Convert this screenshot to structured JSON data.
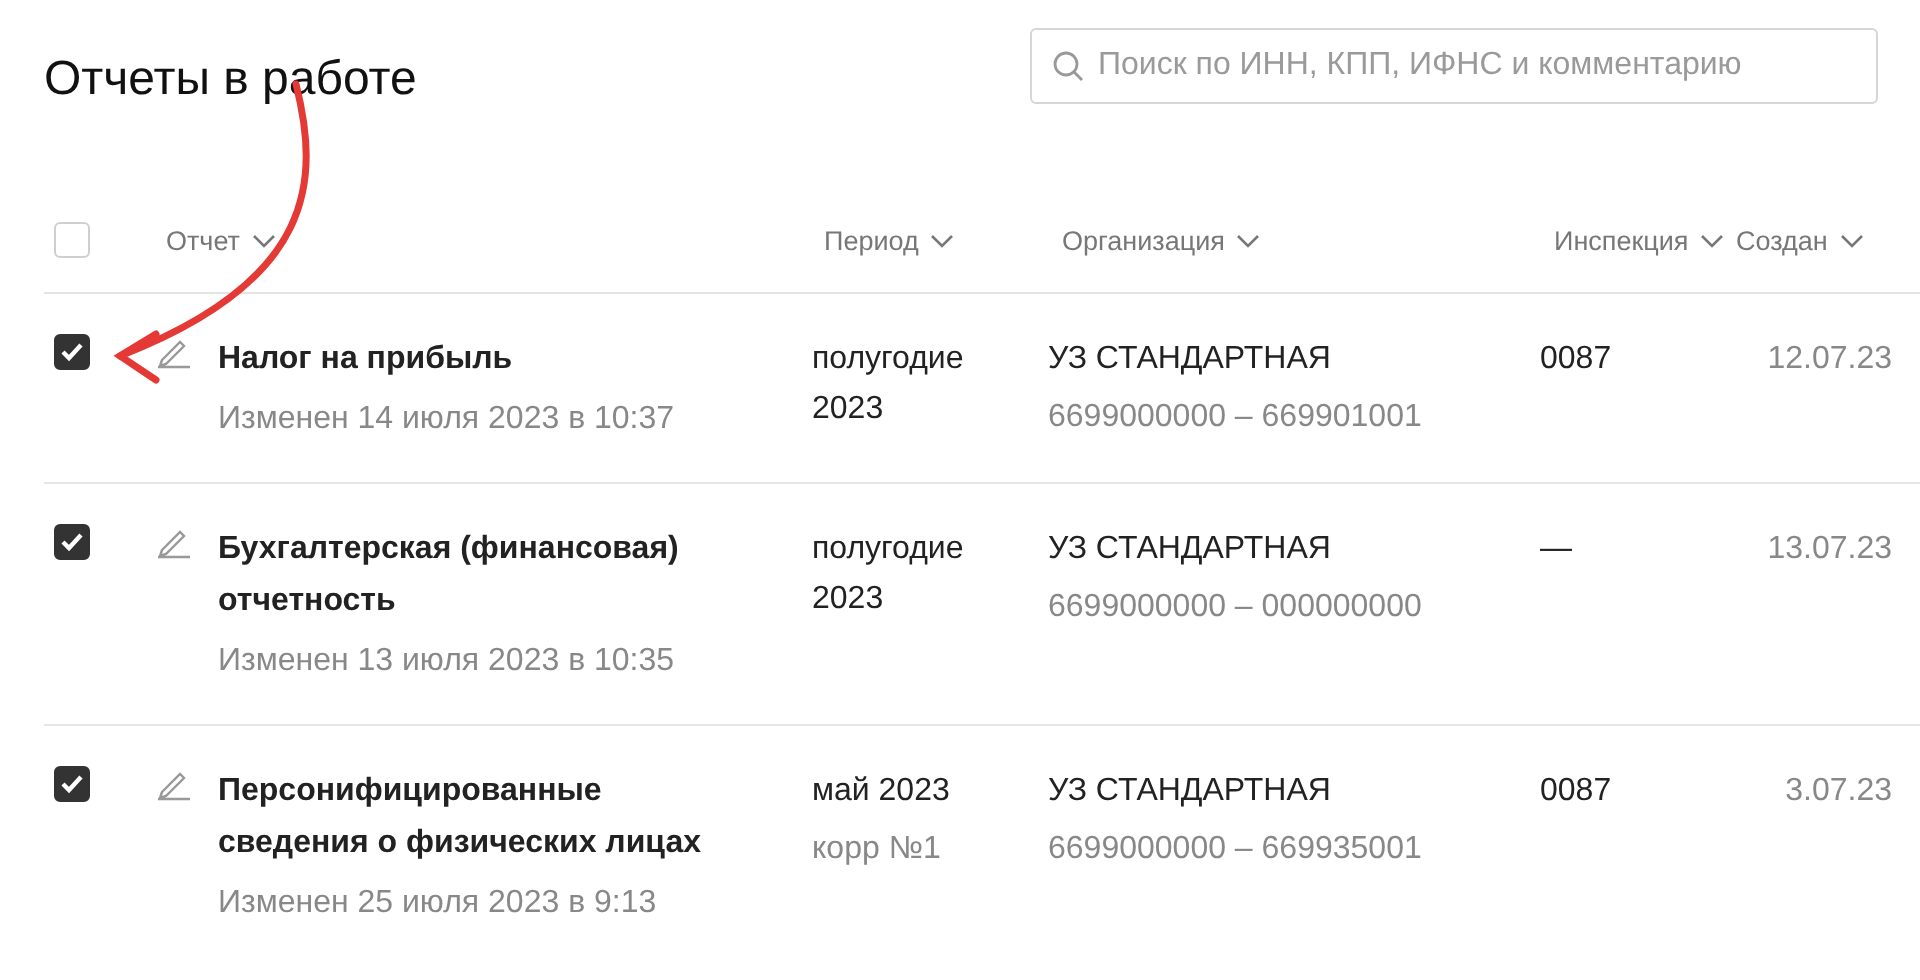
{
  "title": "Отчеты в работе",
  "search": {
    "placeholder": "Поиск по ИНН, КПП, ИФНС и комментарию"
  },
  "table": {
    "select_all": {
      "checked": false
    },
    "columns": [
      "Отчет",
      "Период",
      "Организация",
      "Инспекция",
      "Создан"
    ],
    "rows": [
      {
        "checked": true,
        "title": "Налог на прибыль",
        "modified": "Изменен 14 июля 2023 в 10:37",
        "period": "полугодие 2023",
        "organization": "УЗ СТАНДАРТНАЯ",
        "org_codes": "6699000000 – 669901001",
        "inspection": "0087",
        "created": "12.07.23"
      },
      {
        "checked": true,
        "title": "Бухгалтерская (финансовая) отчетность",
        "modified": "Изменен 13 июля 2023 в 10:35",
        "period": "полугодие 2023",
        "organization": "УЗ СТАНДАРТНАЯ",
        "org_codes": "6699000000 – 000000000",
        "inspection": "—",
        "created": "13.07.23"
      },
      {
        "checked": true,
        "title": "Персонифицированные сведения о физических лицах",
        "modified": "Изменен 25 июля 2023 в 9:13",
        "period": "май 2023",
        "period_note": "корр №1",
        "organization": "УЗ СТАНДАРТНАЯ",
        "org_codes": "6699000000 – 669935001",
        "inspection": "0087",
        "created": "3.07.23"
      }
    ]
  }
}
